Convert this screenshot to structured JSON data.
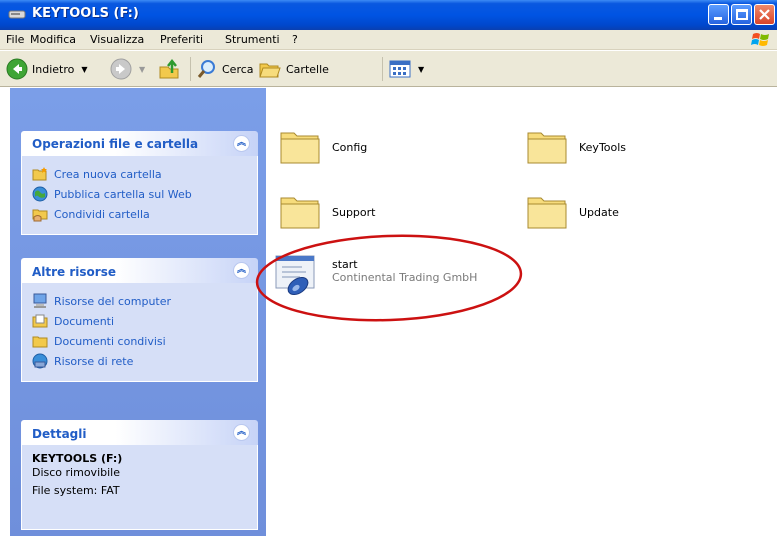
{
  "window": {
    "title": "KEYTOOLS (F:)"
  },
  "menu": [
    "File",
    "Modifica",
    "Visualizza",
    "Preferiti",
    "Strumenti",
    "?"
  ],
  "toolbar": {
    "back_label": "Indietro",
    "search_label": "Cerca",
    "folders_label": "Cartelle"
  },
  "tasks": {
    "file_group_title": "Operazioni file e cartella",
    "file_items": [
      {
        "label": "Crea nuova cartella",
        "icon": "new-folder-icon"
      },
      {
        "label": "Pubblica cartella sul Web",
        "icon": "publish-web-icon"
      },
      {
        "label": "Condividi cartella",
        "icon": "share-folder-icon"
      }
    ],
    "other_group_title": "Altre risorse",
    "other_items": [
      {
        "label": "Risorse del computer",
        "icon": "my-computer-icon"
      },
      {
        "label": "Documenti",
        "icon": "documents-icon"
      },
      {
        "label": "Documenti condivisi",
        "icon": "shared-documents-icon"
      },
      {
        "label": "Risorse di rete",
        "icon": "network-places-icon"
      }
    ],
    "details_title": "Dettagli",
    "details": {
      "name": "KEYTOOLS (F:)",
      "type": "Disco rimovibile",
      "fs": "File system: FAT"
    }
  },
  "files": [
    {
      "name": "Config",
      "type": "folder"
    },
    {
      "name": "KeyTools",
      "type": "folder"
    },
    {
      "name": "Support",
      "type": "folder"
    },
    {
      "name": "Update",
      "type": "folder"
    },
    {
      "name": "start",
      "publisher": "Continental Trading GmbH",
      "type": "setup-app"
    }
  ],
  "colors": {
    "titlebar": "#0054e3",
    "taskpane": "#7b9ee8",
    "task_link": "#215dc6",
    "highlight_ellipse": "#cc1111"
  }
}
